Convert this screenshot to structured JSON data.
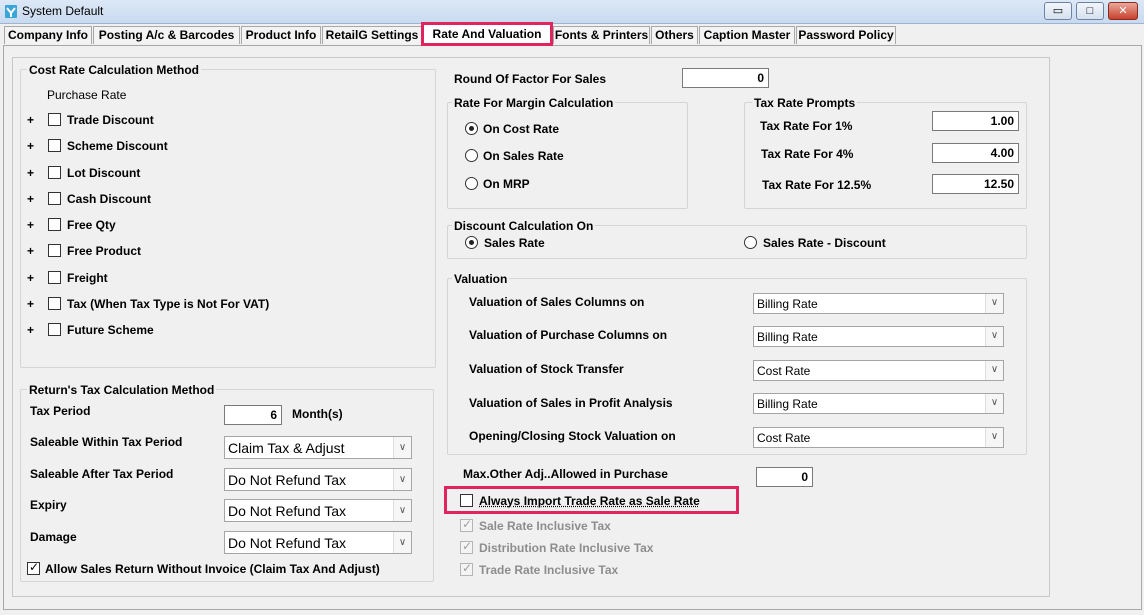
{
  "window": {
    "title": "System Default"
  },
  "tabs": [
    "Company Info",
    "Posting A/c & Barcodes",
    "Product Info",
    "RetailG Settings",
    "Rate And Valuation",
    "Fonts & Printers",
    "Others",
    "Caption Master",
    "Password Policy"
  ],
  "active_tab": "Rate And Valuation",
  "cost_rate": {
    "title": "Cost Rate Calculation Method",
    "subtitle": "Purchase Rate",
    "items": [
      "Trade Discount",
      "Scheme  Discount",
      "Lot Discount",
      "Cash Discount",
      "Free Qty",
      "Free Product",
      "Freight",
      "Tax (When Tax Type is Not For VAT)",
      "Future Scheme"
    ]
  },
  "returns_tax": {
    "title": "Return's Tax Calculation Method",
    "tax_period_label": "Tax Period",
    "tax_period_value": "6",
    "tax_period_unit": "Month(s)",
    "rows": [
      {
        "label": "Saleable  Within Tax Period",
        "value": "Claim Tax & Adjust"
      },
      {
        "label": "Saleable  After Tax Period",
        "value": "Do Not Refund Tax"
      },
      {
        "label": "Expiry",
        "value": "Do Not Refund Tax"
      },
      {
        "label": "Damage",
        "value": "Do Not Refund Tax"
      }
    ],
    "allow_return_label": "Allow Sales Return Without Invoice (Claim Tax And Adjust)",
    "allow_return_checked": true
  },
  "round_off": {
    "label": "Round Of Factor For Sales",
    "value": "0"
  },
  "margin": {
    "title": "Rate For Margin Calculation",
    "options": [
      "On Cost Rate",
      "On Sales Rate",
      "On MRP"
    ],
    "selected": "On Cost Rate"
  },
  "tax_prompts": {
    "title": "Tax Rate Prompts",
    "rows": [
      {
        "label": "Tax Rate For 1%",
        "value": "1.00"
      },
      {
        "label": "Tax Rate For 4%",
        "value": "4.00"
      },
      {
        "label": "Tax Rate For 12.5%",
        "value": "12.50"
      }
    ]
  },
  "discount_calc": {
    "title": "Discount Calculation On",
    "options": [
      "Sales Rate",
      "Sales Rate - Discount"
    ],
    "selected": "Sales Rate"
  },
  "valuation": {
    "title": "Valuation",
    "rows": [
      {
        "label": "Valuation of Sales Columns on",
        "value": "Billing Rate"
      },
      {
        "label": "Valuation of Purchase Columns on",
        "value": "Billing Rate"
      },
      {
        "label": "Valuation of Stock Transfer",
        "value": "Cost Rate"
      },
      {
        "label": "Valuation of Sales in Profit Analysis",
        "value": "Billing Rate"
      },
      {
        "label": "Opening/Closing Stock Valuation on",
        "value": "Cost Rate"
      }
    ]
  },
  "max_other_adj": {
    "label": "Max.Other Adj..Allowed in Purchase",
    "value": "0"
  },
  "always_import": {
    "label": "Always Import Trade Rate as Sale Rate",
    "checked": false
  },
  "inclusive_tax": [
    {
      "label": "Sale Rate Inclusive Tax",
      "checked": true
    },
    {
      "label": "Distribution Rate Inclusive Tax",
      "checked": true
    },
    {
      "label": "Trade Rate Inclusive Tax",
      "checked": true
    }
  ],
  "colors": {
    "highlight": "#e0245e",
    "titlebar": "#c9daf0"
  }
}
